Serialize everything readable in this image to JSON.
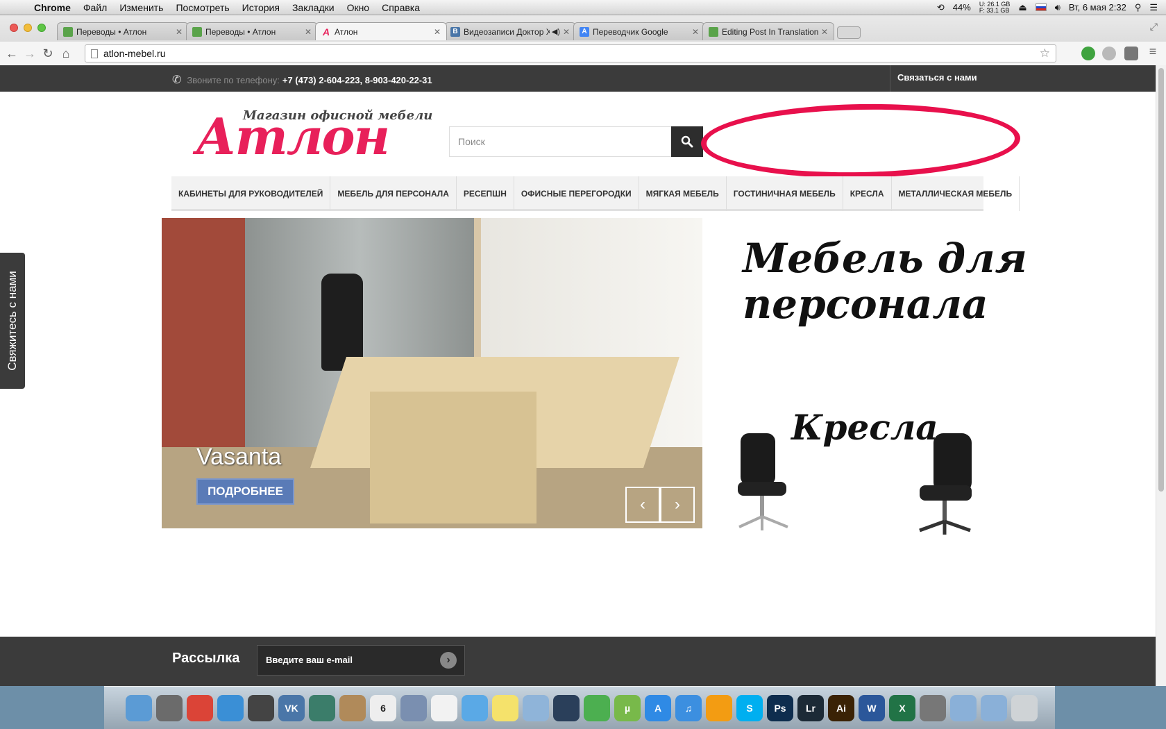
{
  "menubar": {
    "app": "Chrome",
    "items": [
      "Файл",
      "Изменить",
      "Посмотреть",
      "История",
      "Закладки",
      "Окно",
      "Справка"
    ],
    "battery": "44%",
    "disk_u": "U: 26.1 GB",
    "disk_f": "F: 33.1 GB",
    "clock": "Вт, 6 мая  2:32"
  },
  "tabs": [
    {
      "title": "Переводы • Атлон",
      "fav_color": "#5aa34a"
    },
    {
      "title": "Переводы • Атлон",
      "fav_color": "#5aa34a"
    },
    {
      "title": "Атлон",
      "fav_color": "#e8205a"
    },
    {
      "title": "Видеозаписи Доктор Х",
      "fav_color": "#4a76a8"
    },
    {
      "title": "Переводчик Google",
      "fav_color": "#4285f4"
    },
    {
      "title": "Editing Post In Translation",
      "fav_color": "#5aa34a"
    }
  ],
  "address": "atlon-mebel.ru",
  "site": {
    "phone_label": "Звоните по телефону:",
    "phone_number": "+7 (473) 2-604-223, 8-903-420-22-31",
    "contact": "Связаться с нами",
    "logo_sub": "Магазин офисной мебели",
    "logo": "Атлон",
    "search_placeholder": "Поиск",
    "nav": [
      "КАБИНЕТЫ ДЛЯ РУКОВОДИТЕЛЕЙ",
      "МЕБЕЛЬ ДЛЯ ПЕРСОНАЛА",
      "РЕСЕПШН",
      "ОФИСНЫЕ ПЕРЕГОРОДКИ",
      "МЯГКАЯ МЕБЕЛЬ",
      "ГОСТИНИЧНАЯ МЕБЕЛЬ",
      "КРЕСЛА",
      "МЕТАЛЛИЧЕСКАЯ МЕБЕЛЬ"
    ],
    "slide_title": "Vasanta",
    "slide_button": "ПОДРОБНЕЕ",
    "banner_staff_line1": "Мебель для",
    "banner_staff_line2": "персонала",
    "banner_chairs": "Кресла",
    "side_tab": "Свяжитесь с нами",
    "newsletter_label": "Рассылка",
    "newsletter_placeholder": "Введите ваш e-mail"
  },
  "dock": [
    {
      "name": "finder",
      "color": "#5b9bd5"
    },
    {
      "name": "launchpad",
      "color": "#6b6b6b"
    },
    {
      "name": "chrome",
      "color": "#db4437"
    },
    {
      "name": "safari",
      "color": "#3a8fd6"
    },
    {
      "name": "adium",
      "color": "#444"
    },
    {
      "name": "vk",
      "color": "#4a76a8",
      "label": "VK"
    },
    {
      "name": "network",
      "color": "#3b7d6a"
    },
    {
      "name": "contacts",
      "color": "#b08a5a"
    },
    {
      "name": "calendar",
      "color": "#eee",
      "label": "6"
    },
    {
      "name": "preview",
      "color": "#7a8fb0"
    },
    {
      "name": "reminders",
      "color": "#f2f2f2"
    },
    {
      "name": "messages",
      "color": "#5aa9e6"
    },
    {
      "name": "stickies",
      "color": "#f5e26b"
    },
    {
      "name": "photo",
      "color": "#8fb4d9"
    },
    {
      "name": "steam",
      "color": "#2a3f5a"
    },
    {
      "name": "leaf",
      "color": "#4caf50"
    },
    {
      "name": "utorrent",
      "color": "#78b94a",
      "label": "µ"
    },
    {
      "name": "app-store",
      "color": "#2f8ae5",
      "label": "A"
    },
    {
      "name": "itunes",
      "color": "#3c8fe0",
      "label": "♫"
    },
    {
      "name": "ibooks",
      "color": "#f39c12"
    },
    {
      "name": "skype",
      "color": "#00aff0",
      "label": "S"
    },
    {
      "name": "photoshop",
      "color": "#0e2d4e",
      "label": "Ps"
    },
    {
      "name": "lightroom",
      "color": "#1c2a36",
      "label": "Lr"
    },
    {
      "name": "illustrator",
      "color": "#3a2205",
      "label": "Ai"
    },
    {
      "name": "word",
      "color": "#2b579a",
      "label": "W"
    },
    {
      "name": "excel",
      "color": "#217346",
      "label": "X"
    },
    {
      "name": "system-preferences",
      "color": "#777"
    },
    {
      "name": "applications-folder",
      "color": "#8ab0d8"
    },
    {
      "name": "downloads-folder",
      "color": "#8ab0d8"
    },
    {
      "name": "trash",
      "color": "#cfd3d6"
    }
  ]
}
